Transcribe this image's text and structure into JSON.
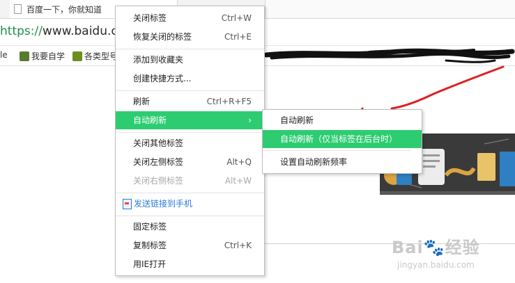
{
  "tab": {
    "title": "百度一下，你就知道"
  },
  "address": {
    "scheme": "https://",
    "host": "www.baidu.com"
  },
  "bookmarks": [
    {
      "label": "le"
    },
    {
      "label": "我要自学"
    },
    {
      "label": "各类型号"
    }
  ],
  "context_menu": {
    "items": [
      {
        "label": "关闭标签",
        "shortcut": "Ctrl+W"
      },
      {
        "label": "恢复关闭的标签",
        "shortcut": "Ctrl+E"
      },
      {
        "label": "添加到收藏夹",
        "shortcut": ""
      },
      {
        "label": "创建快捷方式...",
        "shortcut": ""
      },
      {
        "label": "刷新",
        "shortcut": "Ctrl+R+F5"
      },
      {
        "label": "自动刷新",
        "shortcut": ""
      },
      {
        "label": "关闭其他标签",
        "shortcut": ""
      },
      {
        "label": "关闭左侧标签",
        "shortcut": "Alt+Q"
      },
      {
        "label": "关闭右侧标签",
        "shortcut": "Alt+W"
      },
      {
        "label": "发送链接到手机",
        "shortcut": ""
      },
      {
        "label": "固定标签",
        "shortcut": ""
      },
      {
        "label": "复制标签",
        "shortcut": "Ctrl+K"
      },
      {
        "label": "用IE打开",
        "shortcut": ""
      }
    ],
    "submenu_arrow": "›"
  },
  "submenu": {
    "items": [
      {
        "label": "自动刷新"
      },
      {
        "label": "自动刷新（仅当标签在后台时）"
      },
      {
        "label": "设置自动刷新频率"
      }
    ]
  },
  "watermark": {
    "brand": "Bai",
    "brand2": "经验",
    "site": "jingyan.baidu.com"
  },
  "colors": {
    "highlight": "#2ecc71",
    "annotation": "#e02020",
    "link": "#2b7bd6"
  }
}
